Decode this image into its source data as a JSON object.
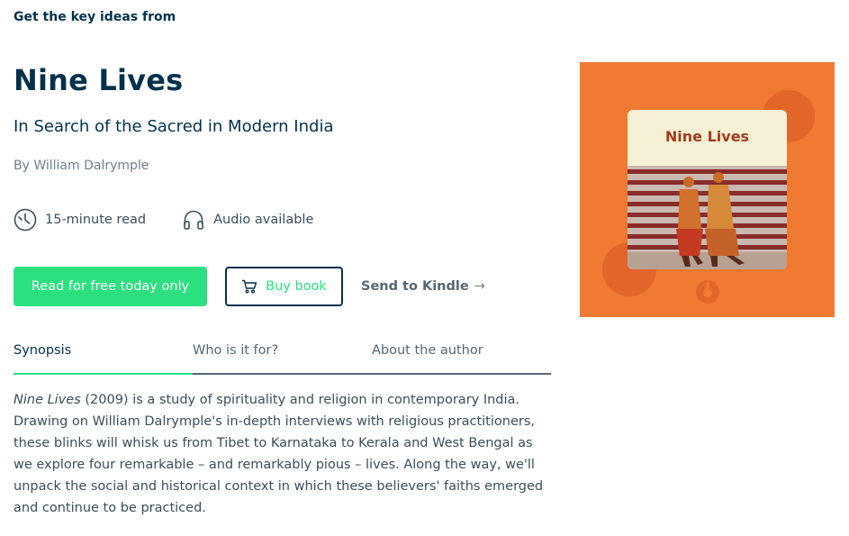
{
  "header": {
    "eyebrow": "Get the key ideas from"
  },
  "book": {
    "title": "Nine Lives",
    "subtitle": "In Search of the Sacred in Modern India",
    "author_line": "By William Dalrymple",
    "cover_title": "Nine Lives"
  },
  "meta": {
    "read_time": "15-minute read",
    "audio": "Audio available"
  },
  "actions": {
    "read_free": "Read for free today only",
    "buy_book": "Buy book",
    "send_kindle": "Send to Kindle",
    "send_kindle_arrow": "→"
  },
  "tabs": [
    {
      "label": "Synopsis",
      "active": true
    },
    {
      "label": "Who is it for?",
      "active": false
    },
    {
      "label": "About the author",
      "active": false
    }
  ],
  "synopsis": {
    "title_italic": "Nine Lives",
    "text": " (2009) is a study of spirituality and religion in contemporary India. Drawing on William Dalrymple's in-depth interviews with religious practitioners, these blinks will whisk us from Tibet to Karnataka to Kerala and West Bengal as we explore four remarkable – and remarkably pious – lives. Along the way, we'll unpack the social and historical context in which these believers' faiths emerged and continue to be practiced."
  },
  "colors": {
    "primary_green": "#2ce080",
    "heading_navy": "#03314b",
    "cover_orange": "#f07a32",
    "cover_title_red": "#a13c1e"
  },
  "icons": {
    "clock": "clock-icon",
    "headphones": "headphones-icon",
    "cart": "cart-icon",
    "arrow": "arrow-right-icon",
    "logo": "blinkist-logo-icon"
  }
}
